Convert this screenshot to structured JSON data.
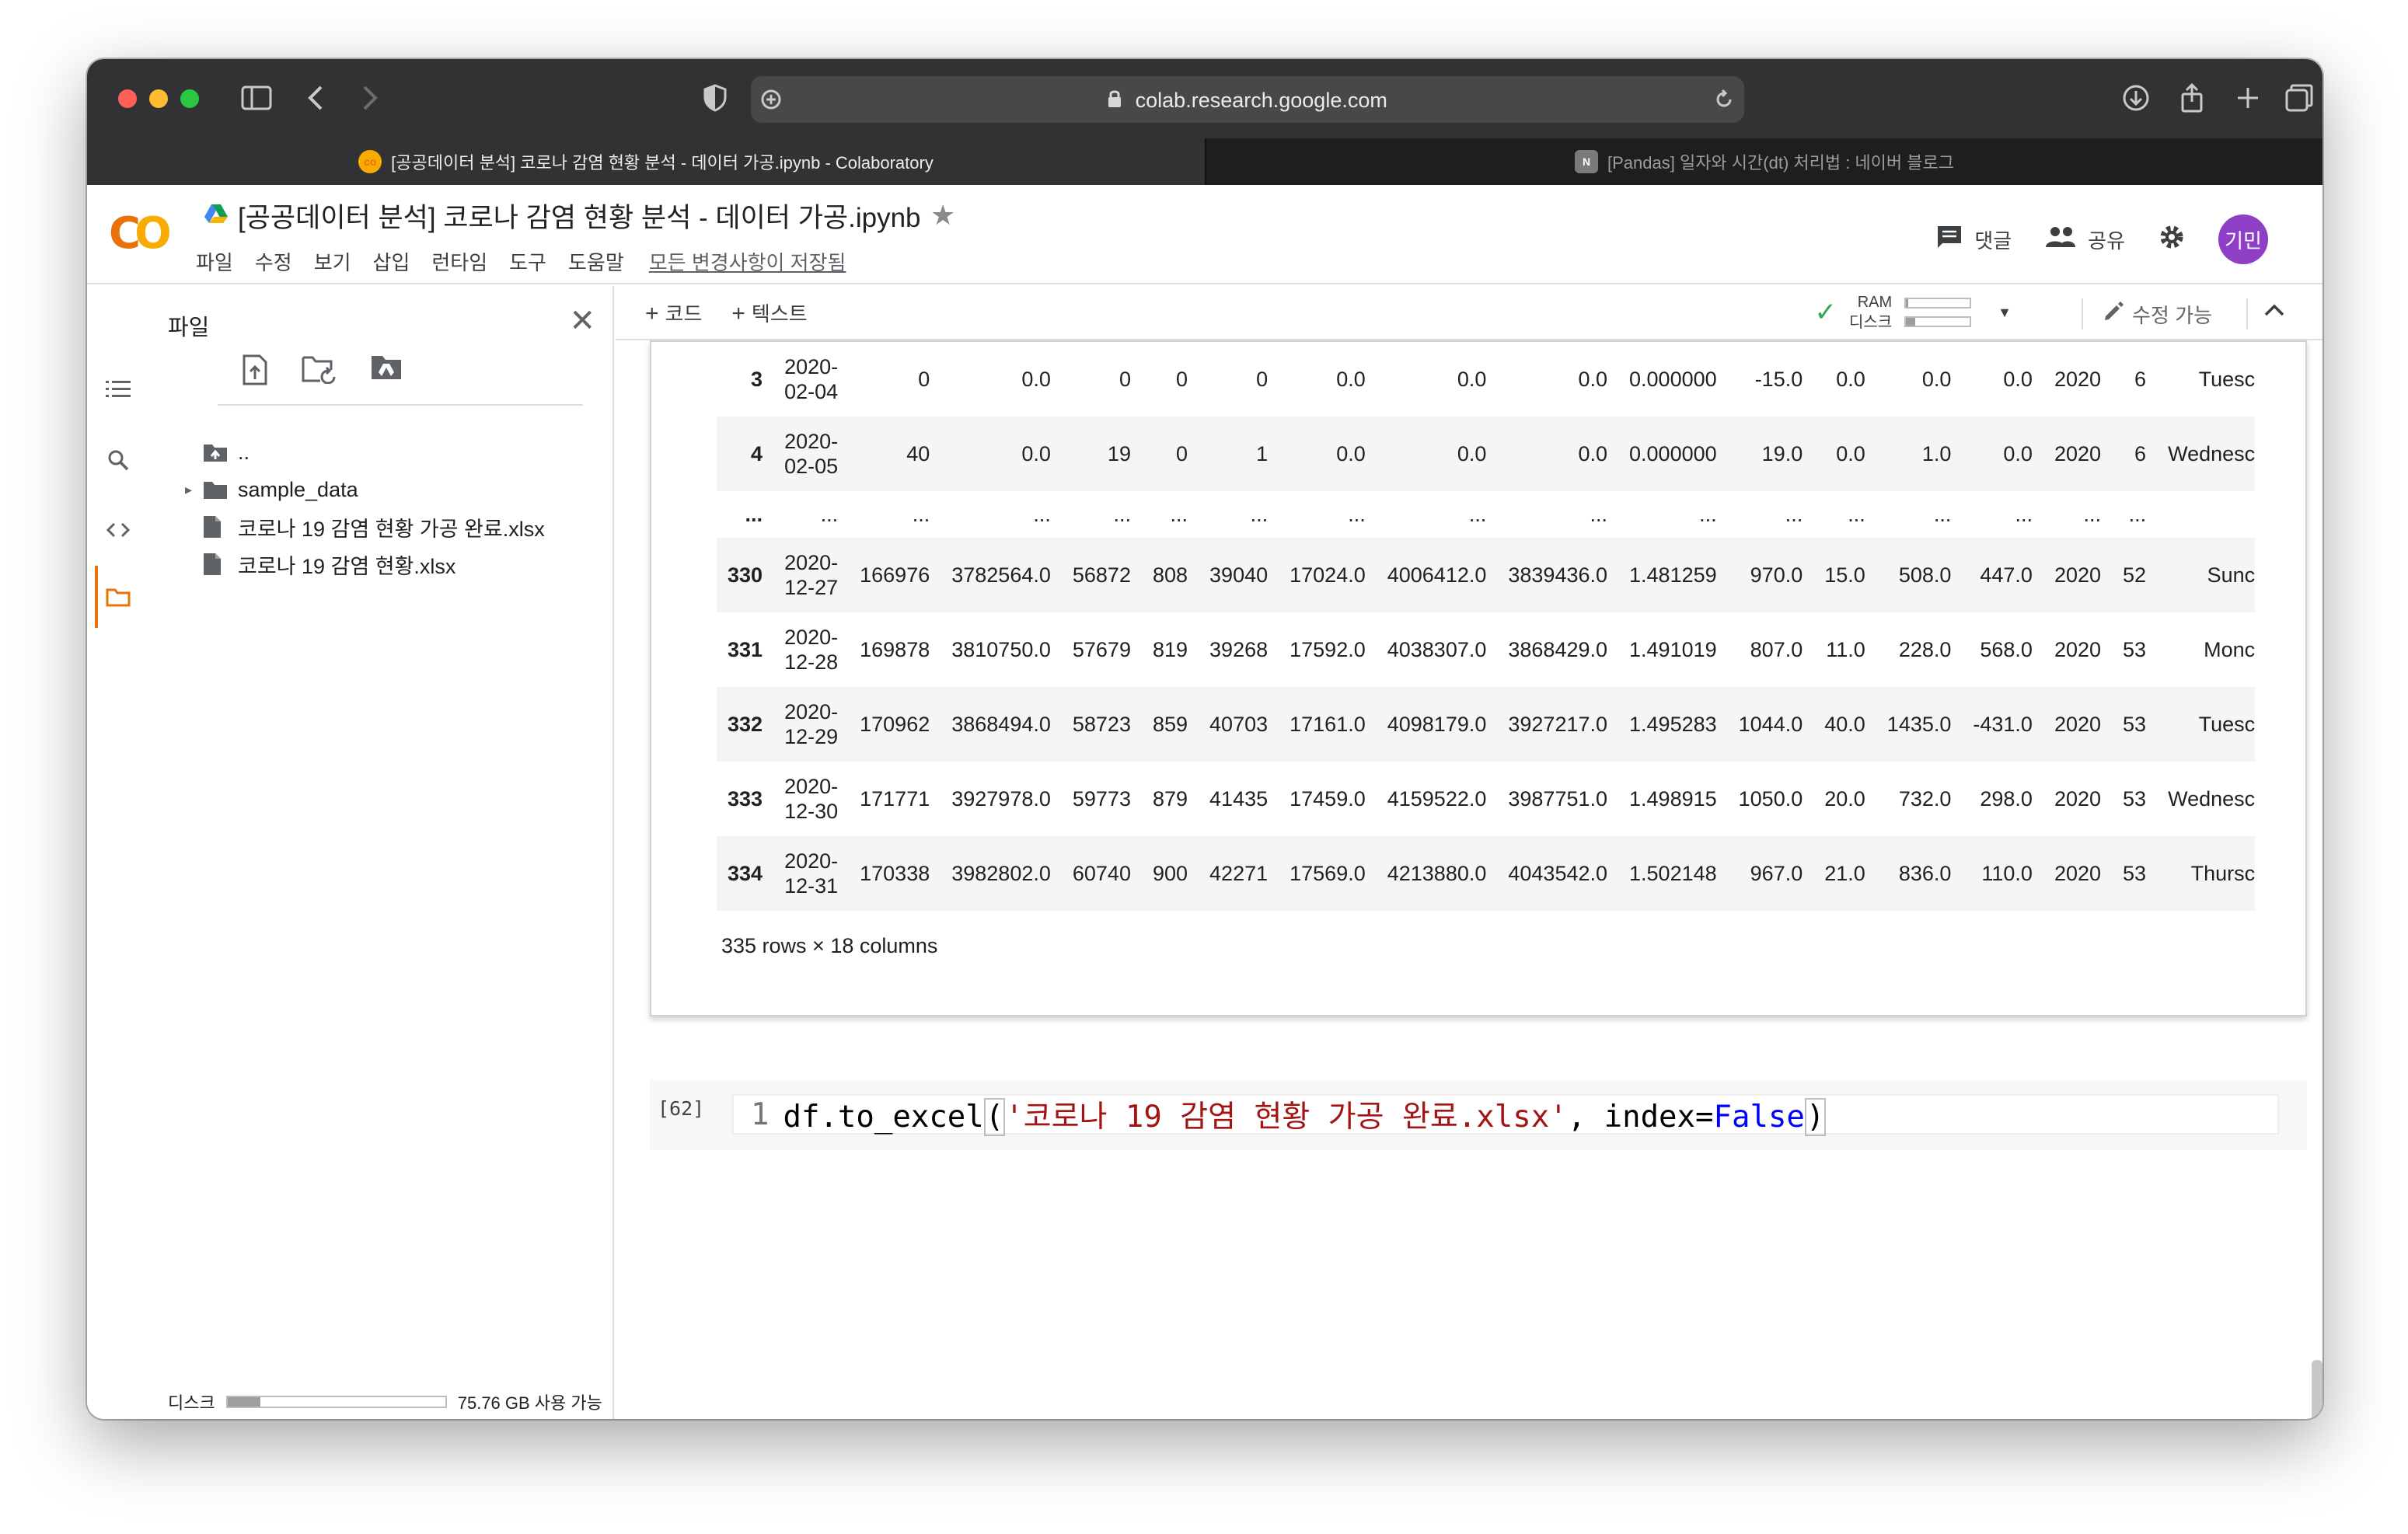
{
  "browser": {
    "url": "colab.research.google.com",
    "tabs": [
      {
        "title": "[공공데이터 분석] 코로나 감염 현황 분석 - 데이터 가공.ipynb - Colaboratory",
        "active": true,
        "favicon": "colab-icon"
      },
      {
        "title": "[Pandas] 일자와 시간(dt) 처리법 : 네이버 블로그",
        "active": false,
        "favicon": "N"
      }
    ]
  },
  "header": {
    "logo": "CO",
    "notebook_title": "[공공데이터 분석] 코로나 감염 현황 분석 - 데이터 가공.ipynb",
    "menu": [
      "파일",
      "수정",
      "보기",
      "삽입",
      "런타임",
      "도구",
      "도움말"
    ],
    "saved_status": "모든 변경사항이 저장됨",
    "comment_label": "댓글",
    "share_label": "공유",
    "avatar_text": "기민"
  },
  "sidebar": {
    "title": "파일",
    "tree": [
      {
        "name": "..",
        "type": "parent",
        "level": 0
      },
      {
        "name": "sample_data",
        "type": "folder",
        "level": 0
      },
      {
        "name": "코로나 19 감염 현황 가공 완료.xlsx",
        "type": "file",
        "level": 0
      },
      {
        "name": "코로나 19 감염 현황.xlsx",
        "type": "file",
        "level": 0
      }
    ],
    "disk_label": "디스크",
    "disk_free": "75.76 GB 사용 가능",
    "disk_used_fraction": 0.15
  },
  "toolbar": {
    "add_code": "코드",
    "add_text": "텍스트",
    "ram_label": "RAM",
    "disk_label": "디스크",
    "ram_used_fraction": 0.03,
    "disk_used_fraction": 0.15,
    "edit_mode": "수정 가능"
  },
  "dataframe": {
    "rows": [
      [
        "3",
        "2020-\n02-04",
        "0",
        "0.0",
        "0",
        "0",
        "0",
        "0.0",
        "0.0",
        "0.0",
        "0.000000",
        "-15.0",
        "0.0",
        "0.0",
        "0.0",
        "2020",
        "6",
        "Tuesc"
      ],
      [
        "4",
        "2020-\n02-05",
        "40",
        "0.0",
        "19",
        "0",
        "1",
        "0.0",
        "0.0",
        "0.0",
        "0.000000",
        "19.0",
        "0.0",
        "1.0",
        "0.0",
        "2020",
        "6",
        "Wednesc"
      ],
      [
        "...",
        "...",
        "...",
        "...",
        "...",
        "...",
        "...",
        "...",
        "...",
        "...",
        "...",
        "...",
        "...",
        "...",
        "...",
        "...",
        "...",
        ""
      ],
      [
        "330",
        "2020-\n12-27",
        "166976",
        "3782564.0",
        "56872",
        "808",
        "39040",
        "17024.0",
        "4006412.0",
        "3839436.0",
        "1.481259",
        "970.0",
        "15.0",
        "508.0",
        "447.0",
        "2020",
        "52",
        "Sunc"
      ],
      [
        "331",
        "2020-\n12-28",
        "169878",
        "3810750.0",
        "57679",
        "819",
        "39268",
        "17592.0",
        "4038307.0",
        "3868429.0",
        "1.491019",
        "807.0",
        "11.0",
        "228.0",
        "568.0",
        "2020",
        "53",
        "Monc"
      ],
      [
        "332",
        "2020-\n12-29",
        "170962",
        "3868494.0",
        "58723",
        "859",
        "40703",
        "17161.0",
        "4098179.0",
        "3927217.0",
        "1.495283",
        "1044.0",
        "40.0",
        "1435.0",
        "-431.0",
        "2020",
        "53",
        "Tuesc"
      ],
      [
        "333",
        "2020-\n12-30",
        "171771",
        "3927978.0",
        "59773",
        "879",
        "41435",
        "17459.0",
        "4159522.0",
        "3987751.0",
        "1.498915",
        "1050.0",
        "20.0",
        "732.0",
        "298.0",
        "2020",
        "53",
        "Wednesc"
      ],
      [
        "334",
        "2020-\n12-31",
        "170338",
        "3982802.0",
        "60740",
        "900",
        "42271",
        "17569.0",
        "4213880.0",
        "4043542.0",
        "1.502148",
        "967.0",
        "21.0",
        "836.0",
        "110.0",
        "2020",
        "53",
        "Thursc"
      ]
    ],
    "shape_text": "335 rows × 18 columns"
  },
  "code_cell": {
    "exec_count": "[62]",
    "line_number": "1",
    "tokens": [
      {
        "t": "df.to_excel",
        "c": "plain"
      },
      {
        "t": "(",
        "c": "br"
      },
      {
        "t": "'코로나 19 감염 현황 가공 완료.xlsx'",
        "c": "str"
      },
      {
        "t": ", index=",
        "c": "plain"
      },
      {
        "t": "False",
        "c": "kw"
      },
      {
        "t": ")",
        "c": "br"
      }
    ]
  },
  "colors": {
    "colab_orange": "#e8710a",
    "colab_yellow": "#f9ab00",
    "avatar_purple": "#8e3fc6",
    "string_red": "#a31515",
    "keyword_blue": "#0000ff"
  }
}
